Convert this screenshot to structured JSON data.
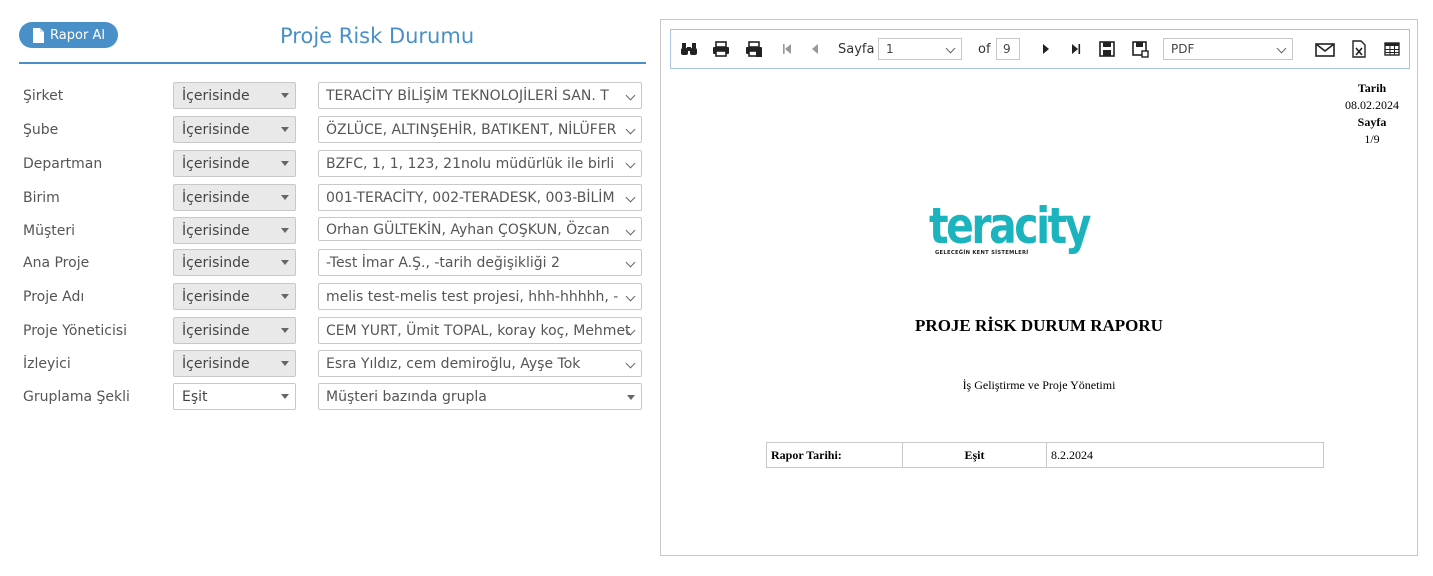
{
  "header": {
    "report_button_label": "Rapor Al",
    "title": "Proje Risk Durumu"
  },
  "filters": [
    {
      "label": "Şirket",
      "operator": "İçerisinde",
      "value": "TERACİTY BİLİŞİM TEKNOLOJİLERİ SAN. T"
    },
    {
      "label": "Şube",
      "operator": "İçerisinde",
      "value": "ÖZLÜCE, ALTINŞEHİR, BATIKENT, NİLÜFER"
    },
    {
      "label": "Departman",
      "operator": "İçerisinde",
      "value": " BZFC, 1, 1, 123, 21nolu müdürlük ile birli"
    },
    {
      "label": "Birim",
      "operator": "İçerisinde",
      "value": "001-TERACİTY, 002-TERADESK, 003-BİLİM"
    },
    {
      "label": "Müşteri",
      "operator": "İçerisinde",
      "value": "Orhan GÜLTEKİN, Ayhan ÇOŞKUN, Özcan"
    },
    {
      "label": "Ana Proje",
      "operator": "İçerisinde",
      "value": "-Test İmar A.Ş., -tarih değişikliği 2"
    },
    {
      "label": "Proje Adı",
      "operator": "İçerisinde",
      "value": "melis test-melis test projesi, hhh-hhhhh, -"
    },
    {
      "label": "Proje Yöneticisi",
      "operator": "İçerisinde",
      "value": "CEM YURT, Ümit TOPAL, koray koç, Mehmet"
    },
    {
      "label": "İzleyici",
      "operator": "İçerisinde",
      "value": "Esra Yıldız, cem demiroğlu, Ayşe Tok"
    },
    {
      "label": "Gruplama Şekli",
      "operator": "Eşit",
      "value": "Müşteri bazında grupla"
    }
  ],
  "viewer": {
    "toolbar": {
      "page_label": "Sayfa",
      "page_value": "1",
      "of_label": "of",
      "total_pages": "9",
      "export_format": "PDF"
    },
    "report": {
      "date_label": "Tarih",
      "date_value": "08.02.2024",
      "page_label": "Sayfa",
      "page_value": "1/9",
      "logo_text": "teracity",
      "logo_tagline": "GELECEĞİN KENT SİSTEMLERİ",
      "title": "PROJE RİSK DURUM RAPORU",
      "subtitle": "İş Geliştirme ve Proje Yönetimi",
      "table": {
        "label": "Rapor Tarihi:",
        "operator": "Eşit",
        "value": "8.2.2024"
      }
    }
  },
  "colors": {
    "accent": "#4a90c8",
    "logo": "#1bb3bd"
  }
}
